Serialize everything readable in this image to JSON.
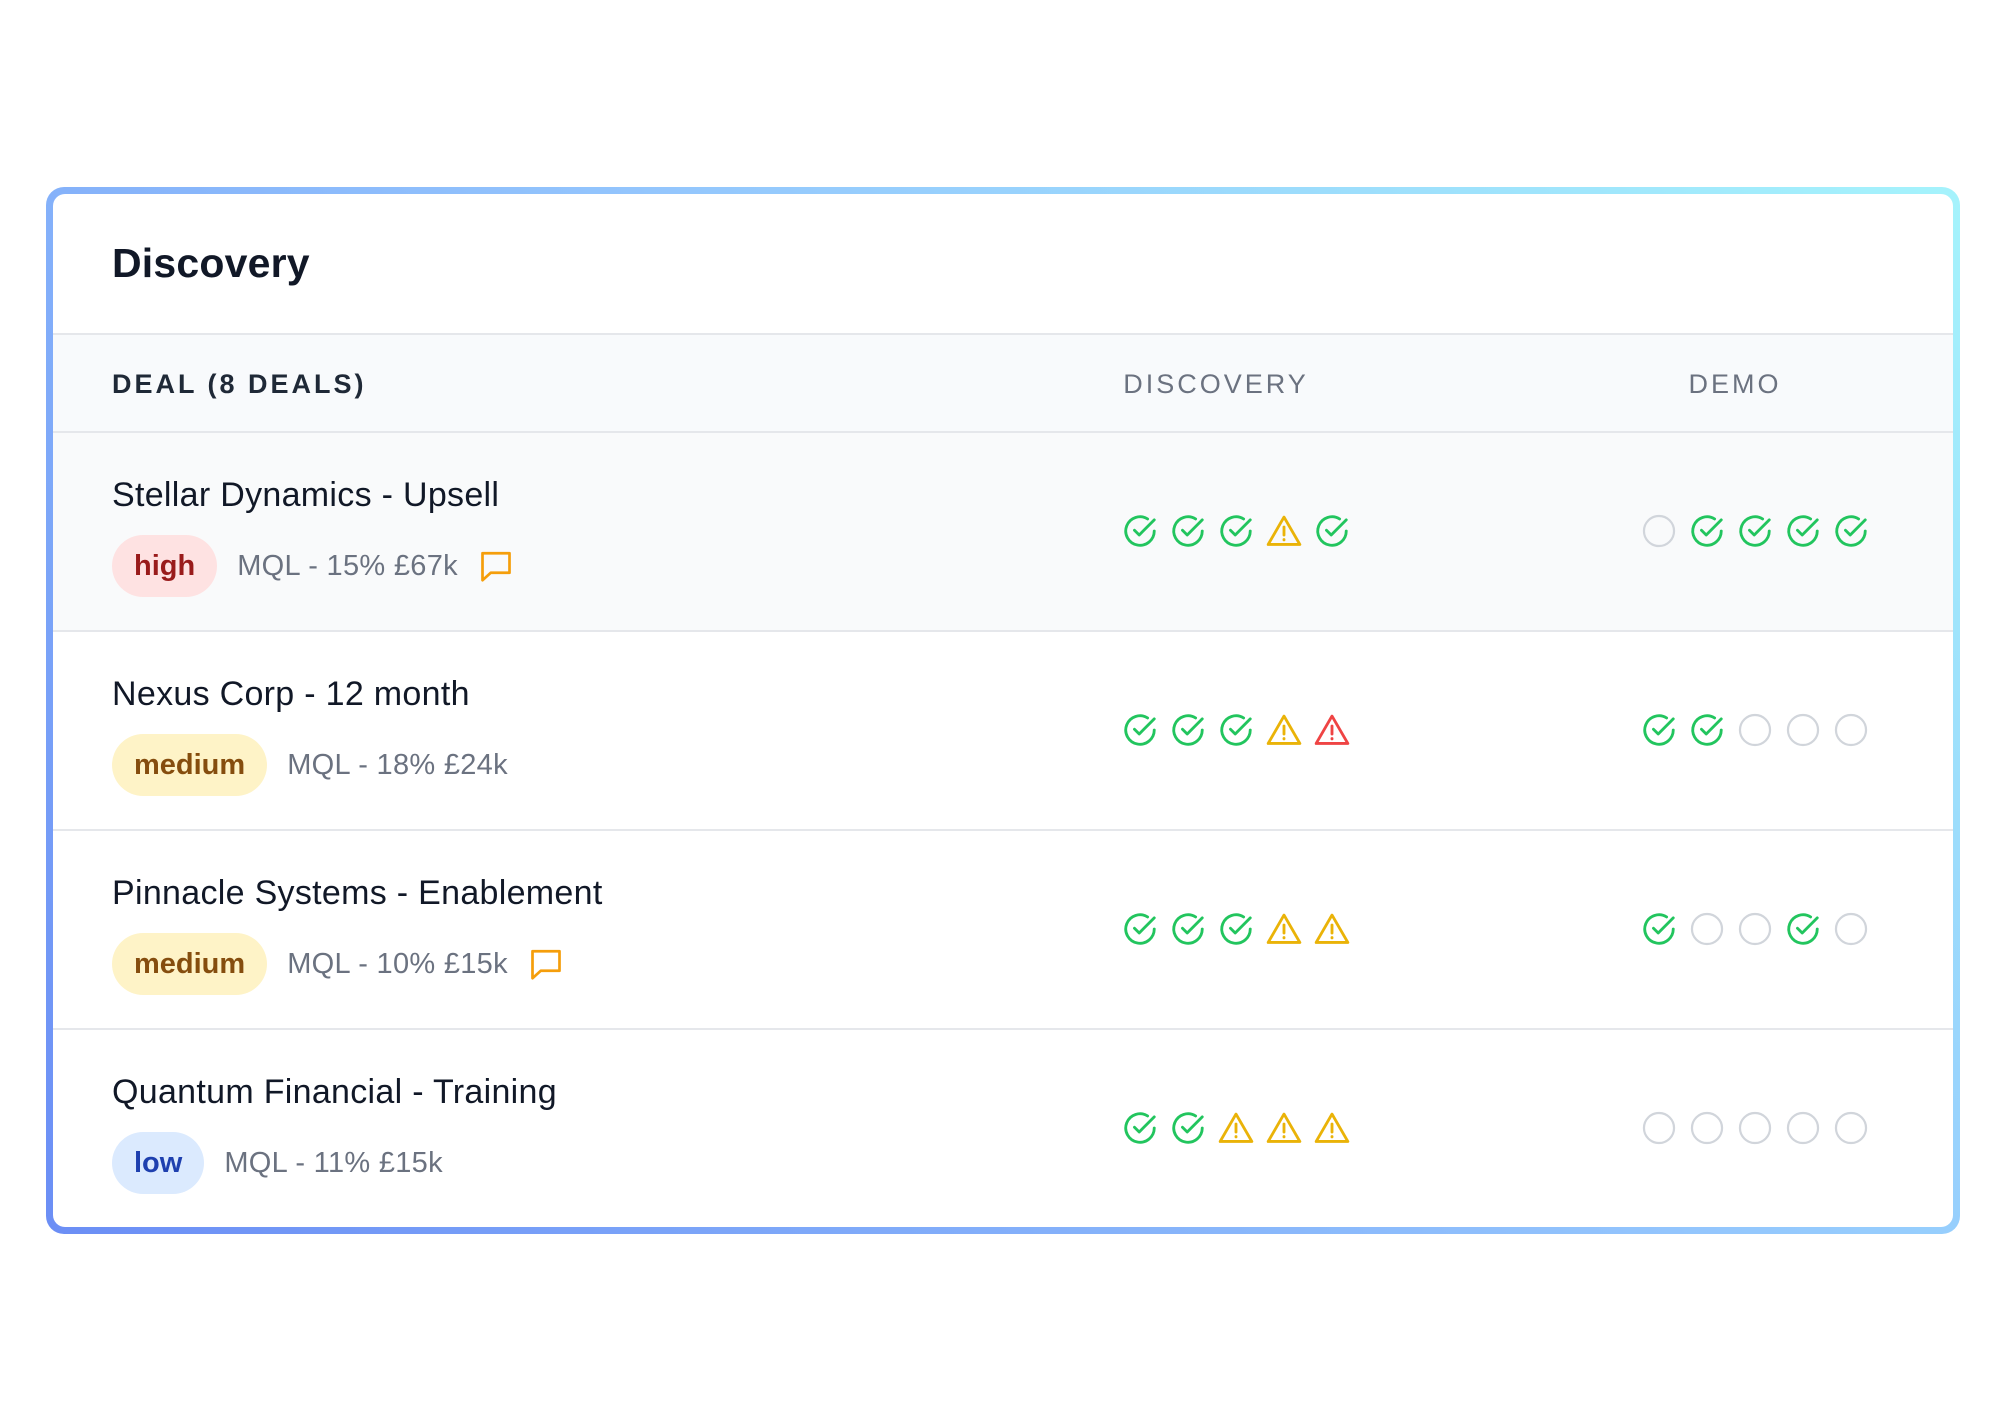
{
  "card": {
    "title": "Discovery"
  },
  "table": {
    "headers": {
      "deal": "DEAL (8 DEALS)",
      "discovery": "DISCOVERY",
      "demo": "DEMO"
    },
    "rows": [
      {
        "name": "Stellar Dynamics - Upsell",
        "priority": "high",
        "meta": "MQL - 15% £67k",
        "has_comment": true,
        "discovery": [
          "check",
          "check",
          "check",
          "warning",
          "check"
        ],
        "demo": [
          "empty",
          "check",
          "check",
          "check",
          "check"
        ]
      },
      {
        "name": "Nexus Corp - 12 month",
        "priority": "medium",
        "meta": "MQL - 18% £24k",
        "has_comment": false,
        "discovery": [
          "check",
          "check",
          "check",
          "warning",
          "alert"
        ],
        "demo": [
          "check",
          "check",
          "empty",
          "empty",
          "empty"
        ]
      },
      {
        "name": "Pinnacle Systems - Enablement",
        "priority": "medium",
        "meta": "MQL - 10% £15k",
        "has_comment": true,
        "discovery": [
          "check",
          "check",
          "check",
          "warning",
          "warning"
        ],
        "demo": [
          "check",
          "empty",
          "empty",
          "check",
          "empty"
        ]
      },
      {
        "name": "Quantum Financial - Training",
        "priority": "low",
        "meta": "MQL - 11% £15k",
        "has_comment": false,
        "discovery": [
          "check",
          "check",
          "warning",
          "warning",
          "warning"
        ],
        "demo": [
          "empty",
          "empty",
          "empty",
          "empty",
          "empty"
        ]
      }
    ]
  },
  "colors": {
    "check": "#22c55e",
    "warning": "#eab308",
    "alert": "#ef4444",
    "empty": "#d1d5db",
    "comment": "#f59e0b"
  },
  "icon_names": {
    "check": "check-circle-icon",
    "warning": "warning-triangle-icon",
    "alert": "alert-triangle-icon",
    "empty": "empty-circle-icon",
    "comment": "comment-icon"
  }
}
